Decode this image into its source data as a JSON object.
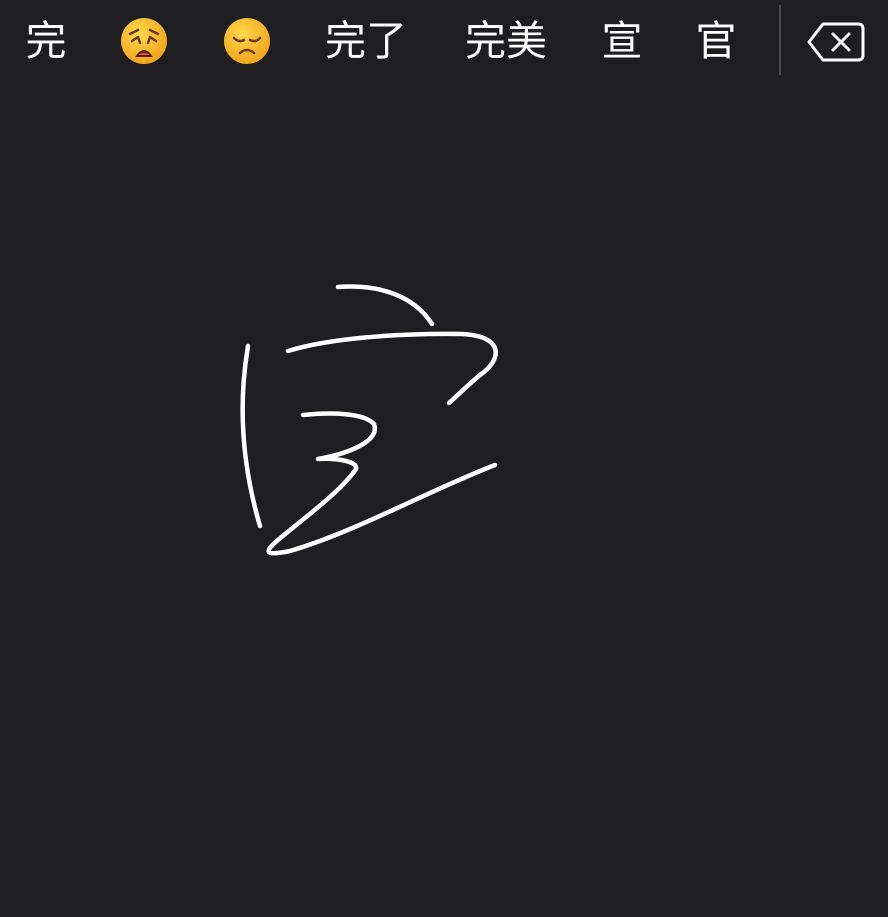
{
  "candidate_bar": {
    "items": [
      {
        "type": "text",
        "label": "完"
      },
      {
        "type": "emoji",
        "icon": "weary-face-emoji"
      },
      {
        "type": "emoji",
        "icon": "disappointed-face-emoji"
      },
      {
        "type": "text",
        "label": "完了"
      },
      {
        "type": "text",
        "label": "完美"
      },
      {
        "type": "text",
        "label": "宣"
      },
      {
        "type": "text",
        "label": "官"
      }
    ],
    "delete_icon": "backspace-icon"
  },
  "handwriting_pad": {
    "background": "#1e1d20",
    "stroke_color": "#ffffff"
  }
}
